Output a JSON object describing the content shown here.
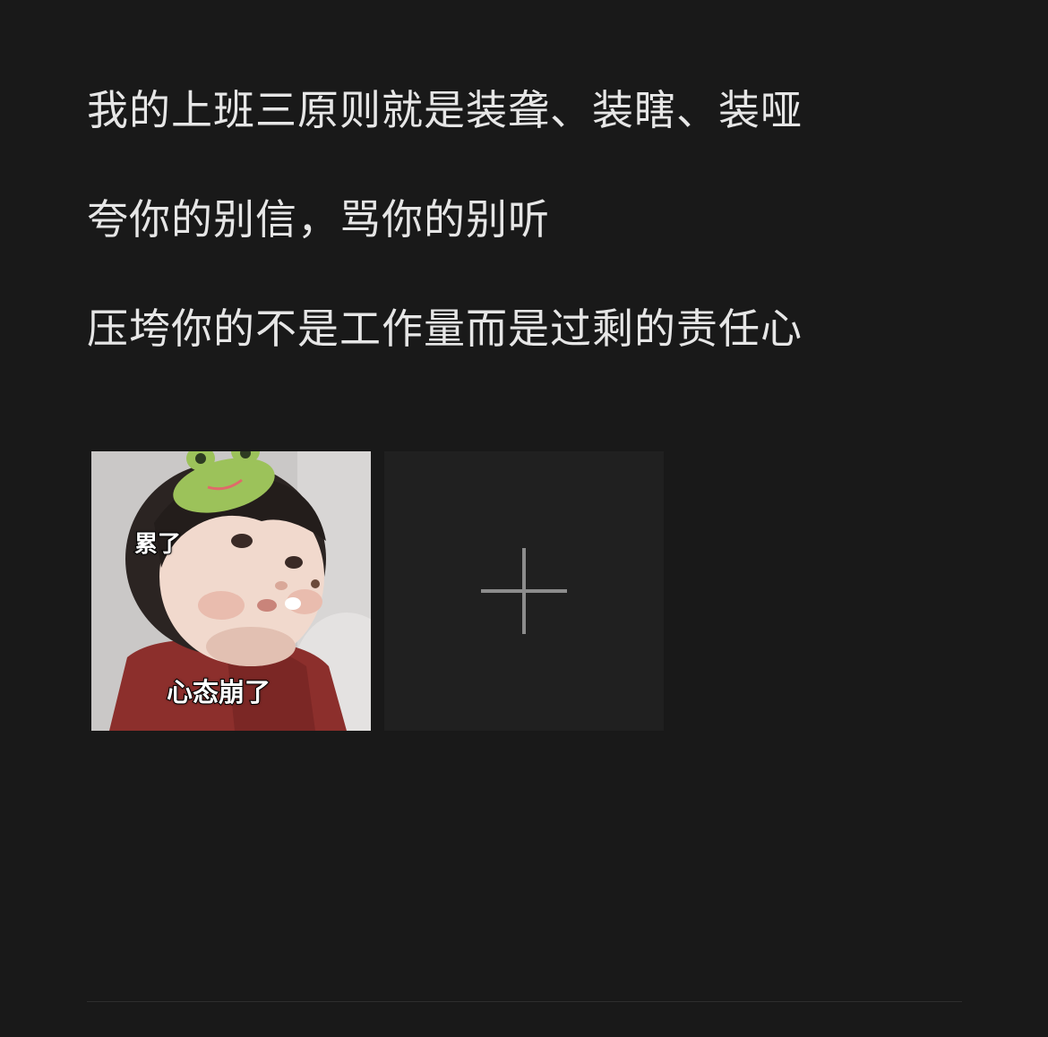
{
  "post": {
    "lines": [
      "我的上班三原则就是装聋、装瞎、装哑",
      "夸你的别信，骂你的别听",
      "压垮你的不是工作量而是过剩的责任心"
    ]
  },
  "media": {
    "image_captions": {
      "top": "累了",
      "bottom": "心态崩了"
    },
    "add_button_icon": "plus-icon"
  },
  "colors": {
    "background": "#191919",
    "text": "#e6e6e6",
    "add_tile": "#202020",
    "plus": "#8c8c8c"
  }
}
